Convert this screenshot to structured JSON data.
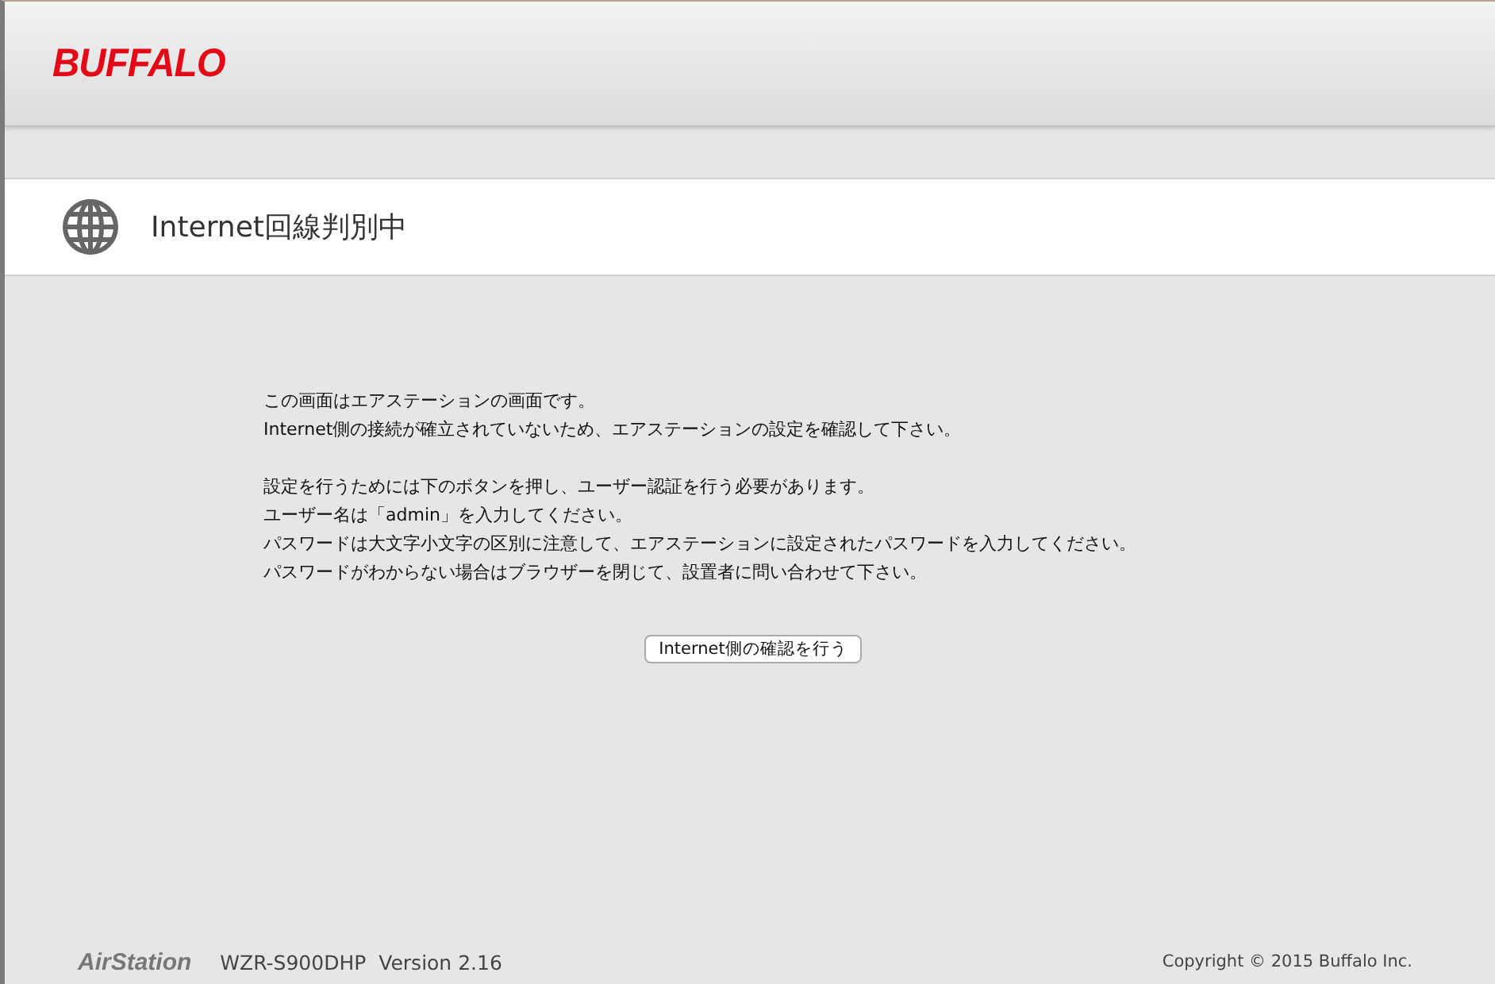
{
  "header": {
    "logo": "BUFFALO"
  },
  "page_title": "Internet回線判別中",
  "paragraphs": [
    [
      "この画面はエアステーションの画面です。",
      "Internet側の接続が確立されていないため、エアステーションの設定を確認して下さい。"
    ],
    [
      "設定を行うためには下のボタンを押し、ユーザー認証を行う必要があります。",
      "ユーザー名は「admin」を入力してください。",
      "パスワードは大文字小文字の区別に注意して、エアステーションに設定されたパスワードを入力してください。",
      "パスワードがわからない場合はブラウザーを閉じて、設置者に問い合わせて下さい。"
    ]
  ],
  "button": "Internet側の確認を行う",
  "footer": {
    "product": "AirStation",
    "model": "WZR-S900DHP",
    "version": "Version 2.16",
    "copyright": "Copyright © 2015 Buffalo Inc."
  }
}
